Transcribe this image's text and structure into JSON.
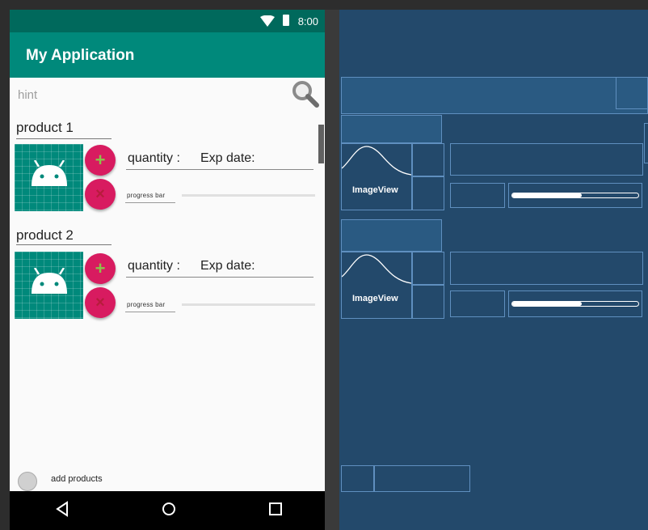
{
  "status_bar": {
    "time": "8:00"
  },
  "app_bar": {
    "title": "My Application"
  },
  "search": {
    "hint": "hint"
  },
  "products": [
    {
      "name": "product 1",
      "quantity_label": "quantity :",
      "exp_label": "Exp date:",
      "progress_label": "progress bar",
      "add_symbol": "+",
      "remove_symbol": "×"
    },
    {
      "name": "product 2",
      "quantity_label": "quantity :",
      "exp_label": "Exp date:",
      "progress_label": "progress bar",
      "add_symbol": "+",
      "remove_symbol": "×"
    }
  ],
  "footer": {
    "add_products_label": "add products"
  },
  "nav": {
    "back": "◁",
    "home": "○",
    "recents": "□"
  },
  "blueprint": {
    "image_label": "ImageView",
    "progress_fraction": 0.55
  },
  "colors": {
    "primary": "#00897b",
    "primary_dark": "#00695c",
    "fab": "#d81b60",
    "blueprint_bg": "#23496b",
    "blueprint_line": "#5f8fbf"
  },
  "icons": {
    "search": "search-icon",
    "wifi": "wifi-icon",
    "battery": "battery-icon",
    "android": "android-logo-icon",
    "add_products": "add-products-icon"
  }
}
